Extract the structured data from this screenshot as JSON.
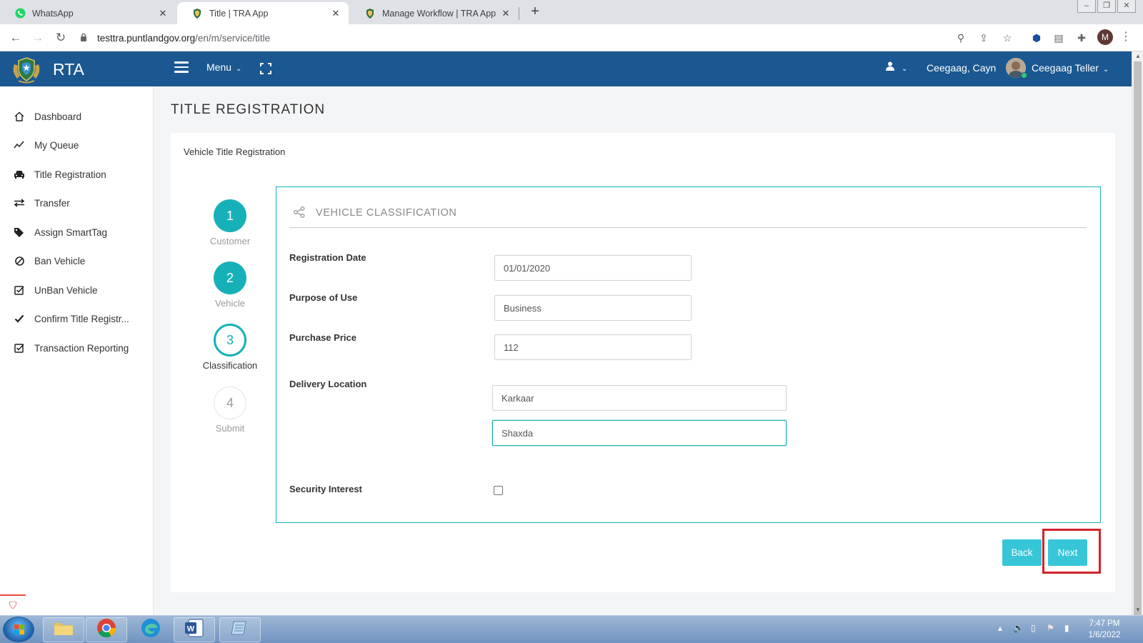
{
  "browser": {
    "tabs": [
      {
        "title": "WhatsApp",
        "active": false
      },
      {
        "title": "Title | TRA App",
        "active": true
      },
      {
        "title": "Manage Workflow | TRA App",
        "active": false
      }
    ],
    "url_host": "testtra.puntlandgov.org",
    "url_path": "/en/m/service/title",
    "profile_initial": "M"
  },
  "header": {
    "brand": "RTA",
    "menu_label": "Menu",
    "user_short": "Ceegaag, Cayn",
    "user_full": "Ceegaag Teller"
  },
  "sidebar": {
    "items": [
      {
        "label": "Dashboard",
        "icon": "home-icon"
      },
      {
        "label": "My Queue",
        "icon": "trend-line-icon"
      },
      {
        "label": "Title Registration",
        "icon": "car-icon"
      },
      {
        "label": "Transfer",
        "icon": "exchange-icon"
      },
      {
        "label": "Assign SmartTag",
        "icon": "tags-icon"
      },
      {
        "label": "Ban Vehicle",
        "icon": "ban-icon"
      },
      {
        "label": "UnBan Vehicle",
        "icon": "check-square-icon"
      },
      {
        "label": "Confirm Title Registr...",
        "icon": "check-icon"
      },
      {
        "label": "Transaction Reporting",
        "icon": "check-square-icon"
      }
    ]
  },
  "page": {
    "title": "TITLE REGISTRATION",
    "card_title": "Vehicle Title Registration"
  },
  "wizard": {
    "steps": [
      {
        "number": "1",
        "label": "Customer",
        "state": "done"
      },
      {
        "number": "2",
        "label": "Vehicle",
        "state": "done"
      },
      {
        "number": "3",
        "label": "Classification",
        "state": "current"
      },
      {
        "number": "4",
        "label": "Submit",
        "state": "todo"
      }
    ],
    "section_title": "VEHICLE CLASSIFICATION"
  },
  "form": {
    "registration_date": {
      "label": "Registration Date",
      "value": "01/01/2020"
    },
    "purpose_of_use": {
      "label": "Purpose of Use",
      "value": "Business"
    },
    "purchase_price": {
      "label": "Purchase Price",
      "value": "112"
    },
    "delivery_location": {
      "label": "Delivery Location",
      "value1": "Karkaar",
      "value2": "Shaxda"
    },
    "security_interest": {
      "label": "Security Interest",
      "checked": false
    }
  },
  "buttons": {
    "back": "Back",
    "next": "Next"
  },
  "taskbar": {
    "time": "7:47 PM",
    "date": "1/6/2022"
  },
  "colors": {
    "header_blue": "#1b5891",
    "teal": "#16b1b8",
    "button_cyan": "#37c6d8",
    "highlight_red": "#d4222a"
  }
}
